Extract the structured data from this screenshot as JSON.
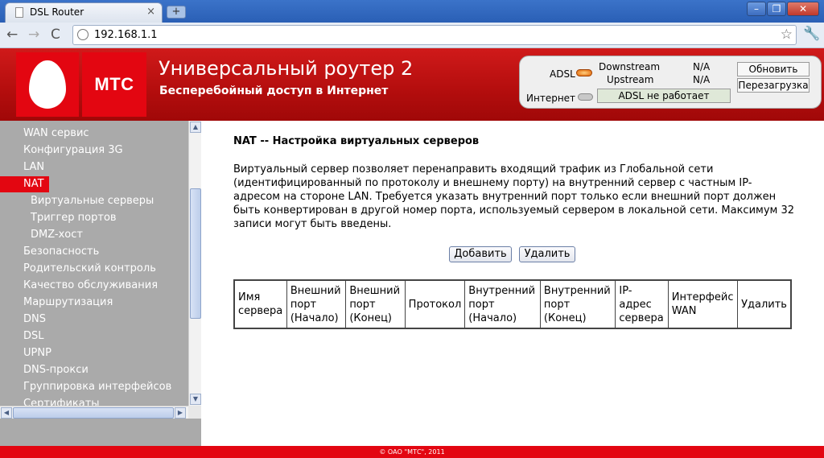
{
  "browser": {
    "tab_title": "DSL Router",
    "tab_close": "×",
    "new_tab": "+",
    "url": "192.168.1.1",
    "back": "←",
    "forward": "→",
    "reload": "C",
    "star": "☆",
    "wrench": "🔧",
    "win_min": "–",
    "win_max": "❐",
    "win_close": "✕"
  },
  "header": {
    "logo_text": "МТС",
    "title": "Универсальный роутер 2",
    "subtitle": "Бесперебойный доступ в Интернет"
  },
  "status_panel": {
    "adsl_label": "ADSL",
    "downstream_label": "Downstream",
    "upstream_label": "Upstream",
    "downstream_value": "N/A",
    "upstream_value": "N/A",
    "internet_label": "Интернет",
    "adsl_status": "ADSL не работает",
    "refresh_label": "Обновить",
    "reboot_label": "Перезагрузка",
    "adsl_led_color": "#e06000",
    "internet_led_color": "#c8c8c8"
  },
  "sidebar": {
    "items": [
      {
        "label": "WAN сервис",
        "level": 1
      },
      {
        "label": "Конфигурация 3G",
        "level": 1
      },
      {
        "label": "LAN",
        "level": 1
      },
      {
        "label": "NAT",
        "level": 1,
        "active": true
      },
      {
        "label": "Виртуальные серверы",
        "level": 2
      },
      {
        "label": "Триггер портов",
        "level": 2
      },
      {
        "label": "DMZ-хост",
        "level": 2
      },
      {
        "label": "Безопасность",
        "level": 1
      },
      {
        "label": "Родительский контроль",
        "level": 1
      },
      {
        "label": "Качество обслуживания",
        "level": 1
      },
      {
        "label": "Маршрутизация",
        "level": 1
      },
      {
        "label": "DNS",
        "level": 1
      },
      {
        "label": "DSL",
        "level": 1
      },
      {
        "label": "UPNP",
        "level": 1
      },
      {
        "label": "DNS-прокси",
        "level": 1
      },
      {
        "label": "Группировка интерфейсов",
        "level": 1
      },
      {
        "label": "Сертификаты",
        "level": 1
      }
    ],
    "scroll_up": "▲",
    "scroll_down": "▼",
    "scroll_left": "◀",
    "scroll_right": "▶"
  },
  "main": {
    "title": "NAT -- Настройка виртуальных серверов",
    "description": "Виртуальный сервер позволяет перенаправить входящий трафик из Глобальной сети (идентифицированный по протоколу и внешнему порту) на внутренний сервер с частным IP-адресом на стороне LAN. Требуется указать внутренний порт только если внешний порт должен быть конвертирован в другой номер порта, используемый сервером в локальной сети. Максимум 32 записи могут быть введены.",
    "add_label": "Добавить",
    "delete_label": "Удалить",
    "table_headers": [
      "Имя сервера",
      "Внешний порт (Начало)",
      "Внешний порт (Конец)",
      "Протокол",
      "Внутренний порт (Начало)",
      "Внутренний порт (Конец)",
      "IP-адрес сервера",
      "Интерфейс WAN",
      "Удалить"
    ]
  },
  "footer": {
    "copyright": "© ОАО \"МТС\", 2011"
  },
  "colors": {
    "brand_red": "#e30611",
    "sidebar_gray": "#aaaaaa"
  }
}
